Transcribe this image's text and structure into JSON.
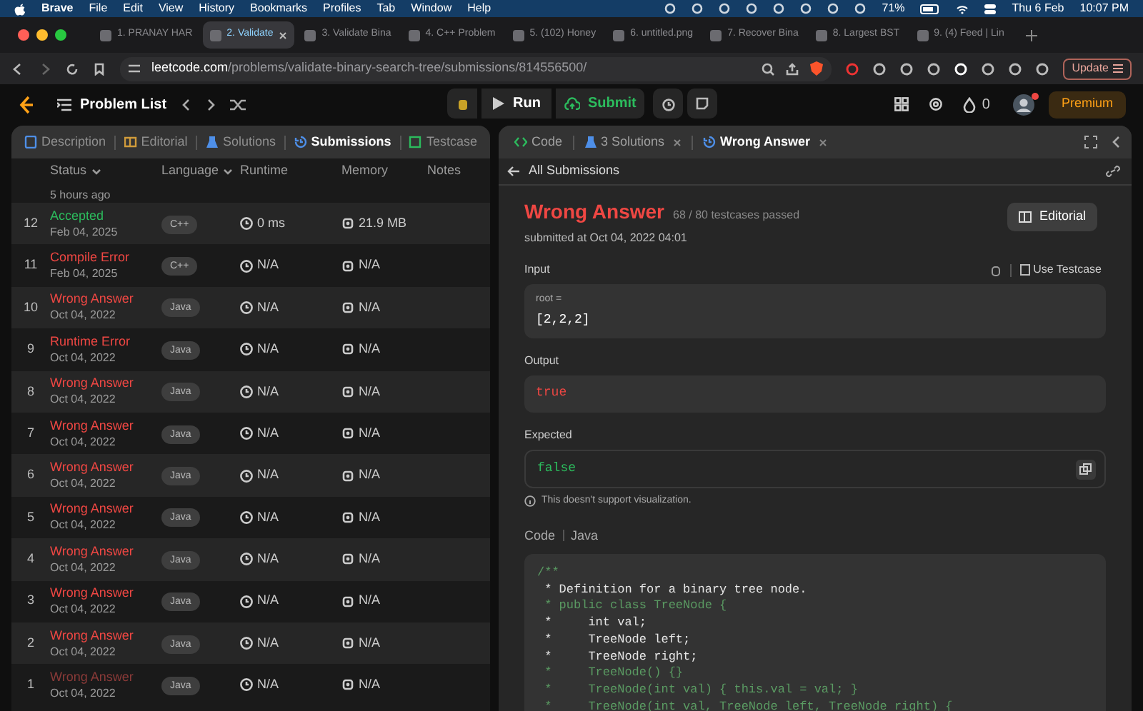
{
  "menu_bar": {
    "app": "Brave",
    "items": [
      "File",
      "Edit",
      "View",
      "History",
      "Bookmarks",
      "Profiles",
      "Tab",
      "Window",
      "Help"
    ],
    "battery": "71%",
    "date": "Thu 6 Feb",
    "time": "10:07 PM"
  },
  "browser_tabs": [
    {
      "title": "1. PRANAY HAR",
      "selected": false
    },
    {
      "title": "2. Validate",
      "selected": true
    },
    {
      "title": "3. Validate Bina",
      "selected": false
    },
    {
      "title": "4. C++ Problem",
      "selected": false
    },
    {
      "title": "5. (102) Honey",
      "selected": false
    },
    {
      "title": "6. untitled.png",
      "selected": false
    },
    {
      "title": "7. Recover Bina",
      "selected": false
    },
    {
      "title": "8. Largest BST",
      "selected": false
    },
    {
      "title": "9. (4) Feed | Lin",
      "selected": false
    }
  ],
  "address_bar": {
    "domain": "leetcode.com",
    "path": "/problems/validate-binary-search-tree/submissions/814556500/",
    "update_button": "Update"
  },
  "toolbar": {
    "problem_list": "Problem List",
    "run": "Run",
    "submit": "Submit",
    "streak": "0",
    "premium": "Premium"
  },
  "left_tabs": [
    {
      "label": "Description",
      "selected": false
    },
    {
      "label": "Editorial",
      "selected": false
    },
    {
      "label": "Solutions",
      "selected": false
    },
    {
      "label": "Submissions",
      "selected": true
    },
    {
      "label": "Testcase",
      "selected": false
    }
  ],
  "submissions": {
    "columns": [
      "Status",
      "Language",
      "Runtime",
      "Memory",
      "Notes"
    ],
    "partial_row": {
      "date": "5 hours ago"
    },
    "rows": [
      {
        "index": "12",
        "status": "Accepted",
        "kind": "accepted",
        "date": "Feb 04, 2025",
        "language": "C++",
        "runtime": "0 ms",
        "memory": "21.9 MB"
      },
      {
        "index": "11",
        "status": "Compile Error",
        "kind": "error",
        "date": "Feb 04, 2025",
        "language": "C++",
        "runtime": "N/A",
        "memory": "N/A"
      },
      {
        "index": "10",
        "status": "Wrong Answer",
        "kind": "error",
        "date": "Oct 04, 2022",
        "language": "Java",
        "runtime": "N/A",
        "memory": "N/A"
      },
      {
        "index": "9",
        "status": "Runtime Error",
        "kind": "error",
        "date": "Oct 04, 2022",
        "language": "Java",
        "runtime": "N/A",
        "memory": "N/A"
      },
      {
        "index": "8",
        "status": "Wrong Answer",
        "kind": "error",
        "date": "Oct 04, 2022",
        "language": "Java",
        "runtime": "N/A",
        "memory": "N/A"
      },
      {
        "index": "7",
        "status": "Wrong Answer",
        "kind": "error",
        "date": "Oct 04, 2022",
        "language": "Java",
        "runtime": "N/A",
        "memory": "N/A"
      },
      {
        "index": "6",
        "status": "Wrong Answer",
        "kind": "error",
        "date": "Oct 04, 2022",
        "language": "Java",
        "runtime": "N/A",
        "memory": "N/A"
      },
      {
        "index": "5",
        "status": "Wrong Answer",
        "kind": "error",
        "date": "Oct 04, 2022",
        "language": "Java",
        "runtime": "N/A",
        "memory": "N/A"
      },
      {
        "index": "4",
        "status": "Wrong Answer",
        "kind": "error",
        "date": "Oct 04, 2022",
        "language": "Java",
        "runtime": "N/A",
        "memory": "N/A"
      },
      {
        "index": "3",
        "status": "Wrong Answer",
        "kind": "error",
        "date": "Oct 04, 2022",
        "language": "Java",
        "runtime": "N/A",
        "memory": "N/A"
      },
      {
        "index": "2",
        "status": "Wrong Answer",
        "kind": "error",
        "date": "Oct 04, 2022",
        "language": "Java",
        "runtime": "N/A",
        "memory": "N/A"
      },
      {
        "index": "1",
        "status": "Wrong Answer",
        "kind": "faded",
        "date": "Oct 04, 2022",
        "language": "Java",
        "runtime": "N/A",
        "memory": "N/A"
      }
    ]
  },
  "right_tabs": [
    {
      "label": "Code",
      "selected": false,
      "closable": false
    },
    {
      "label": "3 Solutions",
      "selected": false,
      "closable": true
    },
    {
      "label": "Wrong Answer",
      "selected": true,
      "closable": true
    }
  ],
  "detail": {
    "back_link": "All Submissions",
    "result": "Wrong Answer",
    "passed": "68 / 80 testcases passed",
    "submitted": "submitted at Oct 04, 2022 04:01",
    "editorial_button": "Editorial",
    "input_label": "Input",
    "use_testcase": "Use Testcase",
    "input_var": "root =",
    "input_value": "[2,2,2]",
    "output_label": "Output",
    "output_value": "true",
    "expected_label": "Expected",
    "expected_value": "false",
    "note": "This doesn't support visualization.",
    "code_label": "Code",
    "code_language": "Java",
    "code_lines": [
      {
        "text": "/**",
        "kind": "comment"
      },
      {
        "text": " * Definition for a binary tree node.",
        "kind": "plain"
      },
      {
        "text": " * public class TreeNode {",
        "kind": "comment"
      },
      {
        "text": " *     int val;",
        "kind": "plain"
      },
      {
        "text": " *     TreeNode left;",
        "kind": "plain"
      },
      {
        "text": " *     TreeNode right;",
        "kind": "plain"
      },
      {
        "text": " *     TreeNode() {}",
        "kind": "comment"
      },
      {
        "text": " *     TreeNode(int val) { this.val = val; }",
        "kind": "comment"
      },
      {
        "text": " *     TreeNode(int val, TreeNode left, TreeNode right) {",
        "kind": "comment"
      }
    ]
  }
}
